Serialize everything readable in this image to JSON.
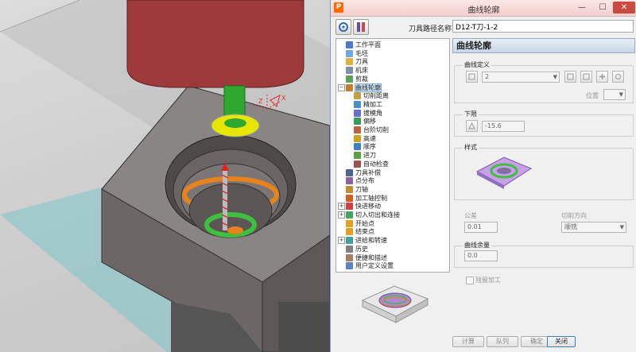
{
  "window": {
    "title": "曲线轮廓",
    "app_icon": "P"
  },
  "toolbar": {
    "path_name_label": "刀具路径名称",
    "path_name_value": "D12-T刀-1-2"
  },
  "tree": {
    "items": [
      {
        "label": "工作平面",
        "icon": "plane-icon",
        "color": "#4a7bc8"
      },
      {
        "label": "毛坯",
        "icon": "stock-icon",
        "color": "#6fa8dc"
      },
      {
        "label": "刀具",
        "icon": "tool-icon",
        "color": "#e0b040"
      },
      {
        "label": "机床",
        "icon": "machine-icon",
        "color": "#7f8fa6"
      },
      {
        "label": "剪裁",
        "icon": "trim-icon",
        "color": "#5fa05f"
      },
      {
        "label": "曲线轮廓",
        "icon": "curve-profile-icon",
        "color": "#c08030"
      },
      {
        "label": "切削距离",
        "icon": "cut-distance-icon",
        "color": "#c0a040"
      },
      {
        "label": "精加工",
        "icon": "finishing-icon",
        "color": "#4a90c8"
      },
      {
        "label": "拔模角",
        "icon": "draft-angle-icon",
        "color": "#6a6ad0"
      },
      {
        "label": "偏移",
        "icon": "offset-icon",
        "color": "#3a9a5a"
      },
      {
        "label": "台阶切削",
        "icon": "step-cut-icon",
        "color": "#c06040"
      },
      {
        "label": "高速",
        "icon": "high-speed-icon",
        "color": "#d0a020"
      },
      {
        "label": "顺序",
        "icon": "order-icon",
        "color": "#4080c0"
      },
      {
        "label": "进刀",
        "icon": "plunge-icon",
        "color": "#60a040"
      },
      {
        "label": "自动检查",
        "icon": "auto-check-icon",
        "color": "#a05050"
      },
      {
        "label": "刀具补偿",
        "icon": "tool-comp-icon",
        "color": "#506090"
      },
      {
        "label": "点分布",
        "icon": "point-dist-icon",
        "color": "#9060a0"
      },
      {
        "label": "刀轴",
        "icon": "tool-axis-icon",
        "color": "#c09030"
      },
      {
        "label": "加工轴控制",
        "icon": "axis-control-icon",
        "color": "#d06020"
      },
      {
        "label": "快进移动",
        "icon": "rapid-move-icon",
        "color": "#d04040"
      },
      {
        "label": "切入切出和连接",
        "icon": "lead-link-icon",
        "color": "#4aa060"
      },
      {
        "label": "开始点",
        "icon": "start-point-icon",
        "color": "#e0a020"
      },
      {
        "label": "结束点",
        "icon": "end-point-icon",
        "color": "#e0a020"
      },
      {
        "label": "进给和转速",
        "icon": "feed-speed-icon",
        "color": "#40a0a0"
      },
      {
        "label": "历史",
        "icon": "history-icon",
        "color": "#808080"
      },
      {
        "label": "便捷和描述",
        "icon": "notes-icon",
        "color": "#a08060"
      },
      {
        "label": "用户定义设置",
        "icon": "user-settings-icon",
        "color": "#6080c0"
      }
    ]
  },
  "panel": {
    "title": "曲线轮廓",
    "curve_def": {
      "group_label": "曲线定义",
      "curve_value": "2",
      "position_label": "位置"
    },
    "lower_limit": {
      "group_label": "下限",
      "value": "-15.6"
    },
    "style": {
      "group_label": "样式"
    },
    "tolerance": {
      "label": "公差",
      "value": "0.01"
    },
    "cut_direction": {
      "label": "切削方向",
      "value": "顺铣"
    },
    "curve_stock": {
      "group_label": "曲线余量",
      "value": "0.0"
    },
    "leave_machining_label": "残留加工"
  },
  "buttons": {
    "calculate": "计算",
    "queue": "队列",
    "ok": "确定",
    "close": "关闭"
  },
  "viewport": {
    "axis_x": "X",
    "axis_z": "Z"
  }
}
